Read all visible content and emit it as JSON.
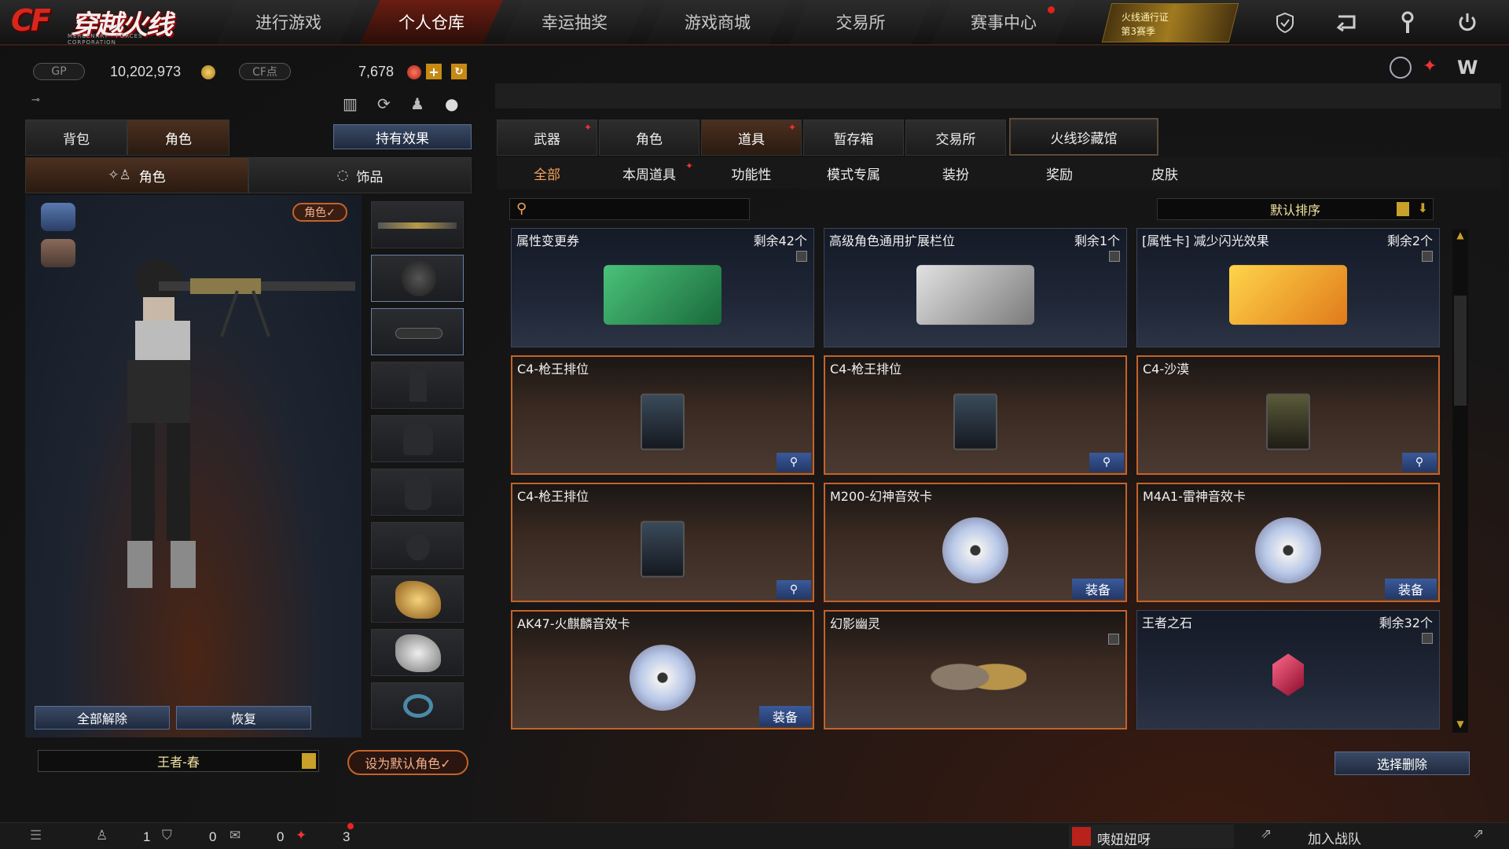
{
  "logo": {
    "main": "CF穿越火线",
    "sub": "MERCENARY · FORCES · CORPORATION"
  },
  "nav": {
    "tabs": [
      "进行游戏",
      "个人仓库",
      "幸运抽奖",
      "游戏商城",
      "交易所",
      "赛事中心"
    ],
    "active_index": 1,
    "pass_label_1": "火线通行证",
    "pass_label_2": "第3赛季"
  },
  "currency": {
    "gp_label": "GP",
    "gp_value": "10,202,973",
    "cf_label": "CF点",
    "cf_value": "7,678"
  },
  "left": {
    "tab_bag": "背包",
    "tab_role": "角色",
    "effect_btn": "持有效果",
    "sub_role": "角色",
    "sub_accessory": "饰品",
    "role_badge": "角色✓",
    "unequip_all": "全部解除",
    "restore": "恢复",
    "role_name": "王者-春",
    "set_default": "设为默认角色✓"
  },
  "right": {
    "main_tabs": [
      "武器",
      "角色",
      "道具",
      "暂存箱",
      "交易所",
      "火线珍藏馆"
    ],
    "main_active_index": 2,
    "sub_tabs": [
      "全部",
      "本周道具",
      "功能性",
      "模式专属",
      "装扮",
      "奖励",
      "皮肤"
    ],
    "sub_active_index": 0,
    "search_placeholder": "",
    "sort_label": "默认排序",
    "delete_btn": "选择删除",
    "items": [
      {
        "name": "属性变更券",
        "count": "剩余42个",
        "type": "ticket-green",
        "action": "trash"
      },
      {
        "name": "高级角色通用扩展栏位",
        "count": "剩余1个",
        "type": "ticket-silver",
        "action": "trash"
      },
      {
        "name": "[属性卡] 减少闪光效果",
        "count": "剩余2个",
        "type": "ticket-gold",
        "action": "trash"
      },
      {
        "name": "C4-枪王排位",
        "count": "",
        "type": "c4",
        "action": "zoom",
        "gold": true
      },
      {
        "name": "C4-枪王排位",
        "count": "",
        "type": "c4",
        "action": "zoom",
        "gold": true
      },
      {
        "name": "C4-沙漠",
        "count": "",
        "type": "c4",
        "action": "zoom",
        "gold": true
      },
      {
        "name": "C4-枪王排位",
        "count": "",
        "type": "c4",
        "action": "zoom",
        "gold": true
      },
      {
        "name": "M200-幻神音效卡",
        "count": "",
        "type": "disc",
        "action": "equip",
        "gold": true
      },
      {
        "name": "M4A1-雷神音效卡",
        "count": "",
        "type": "disc",
        "action": "equip",
        "gold": true
      },
      {
        "name": "AK47-火麒麟音效卡",
        "count": "",
        "type": "disc",
        "action": "equip",
        "gold": true
      },
      {
        "name": "幻影幽灵",
        "count": "",
        "type": "ghost",
        "action": "trash",
        "gold": true
      },
      {
        "name": "王者之石",
        "count": "剩余32个",
        "type": "gem",
        "action": "trash",
        "gold": false
      }
    ],
    "equip_label": "装备"
  },
  "bottom": {
    "count_a": "1",
    "count_b": "0",
    "count_c": "0",
    "count_d": "3",
    "user_name": "咦妞妞呀",
    "join_team": "加入战队"
  },
  "colors": {
    "accent_red": "#c4632a",
    "button_blue": "#233868"
  }
}
